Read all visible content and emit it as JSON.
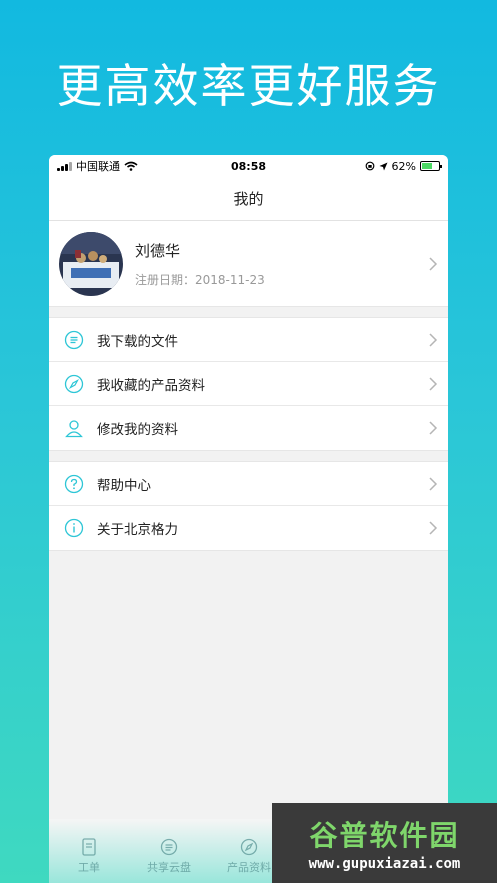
{
  "headline": "更高效率更好服务",
  "status": {
    "carrier": "中国联通",
    "time": "08:58",
    "battery": "62%",
    "battery_level": 0.62
  },
  "nav": {
    "title": "我的"
  },
  "profile": {
    "name": "刘德华",
    "date": "注册日期：2018-11-23"
  },
  "menu_group_1": [
    {
      "label": "我下载的文件",
      "icon": "file-list-icon"
    },
    {
      "label": "我收藏的产品资料",
      "icon": "compass-icon"
    },
    {
      "label": "修改我的资料",
      "icon": "user-icon"
    }
  ],
  "menu_group_2": [
    {
      "label": "帮助中心",
      "icon": "help-icon"
    },
    {
      "label": "关于北京格力",
      "icon": "info-icon"
    }
  ],
  "tabs": [
    {
      "label": "工单",
      "icon": "document-icon"
    },
    {
      "label": "共享云盘",
      "icon": "list-circle-icon"
    },
    {
      "label": "产品资料",
      "icon": "compass-icon"
    }
  ],
  "watermark": {
    "title": "谷普软件园",
    "url": "www.gupuxiazai.com"
  },
  "colors": {
    "accent": "#2ec6d6",
    "bg_top": "#12b9e0",
    "bg_bottom": "#3fd9c0"
  }
}
